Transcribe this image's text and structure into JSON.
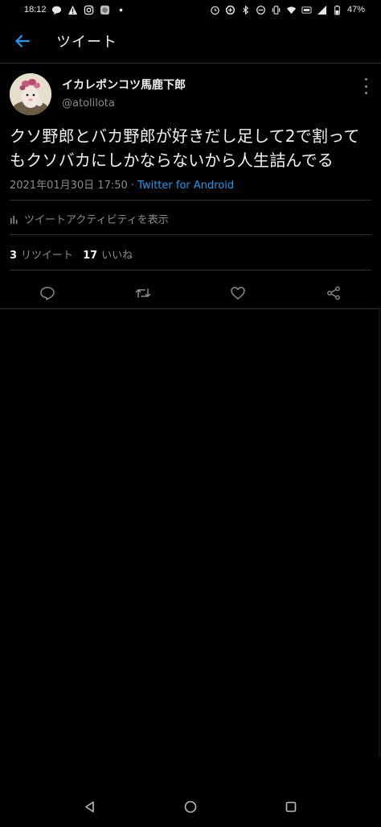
{
  "status_bar": {
    "time": "18:12",
    "battery": "47%",
    "icons_left": [
      "chat-icon",
      "warning-icon",
      "instagram-icon",
      "app-icon",
      "dot-icon"
    ],
    "icons_right": [
      "alarm-icon",
      "data-saver-icon",
      "bluetooth-icon",
      "dnd-icon",
      "vibrate-icon",
      "wifi-icon",
      "volte-icon",
      "signal-icon",
      "battery-icon"
    ]
  },
  "header": {
    "title": "ツイート",
    "back_icon": "arrow-left-icon"
  },
  "tweet": {
    "author_name": "イカレポンコツ馬鹿下郎",
    "handle": "@atolilota",
    "text": "クソ野郎とバカ野郎が好きだし足して2で割ってもクソバカにしかならないから人生詰んでる",
    "timestamp": "2021年01月30日 17:50 · ",
    "source": "Twitter for Android",
    "activity_label": "ツイートアクティビティを表示",
    "retweet_count": "3",
    "retweet_label": "リツイート",
    "like_count": "17",
    "like_label": "いいね"
  },
  "actions": [
    "reply-icon",
    "retweet-icon",
    "like-icon",
    "share-icon"
  ],
  "nav": [
    "back-triangle-icon",
    "home-circle-icon",
    "recents-square-icon"
  ],
  "colors": {
    "background": "#000000",
    "accent": "#1d9bf0",
    "secondary_text": "#8b8b8b",
    "divider": "#2f2f2f"
  }
}
